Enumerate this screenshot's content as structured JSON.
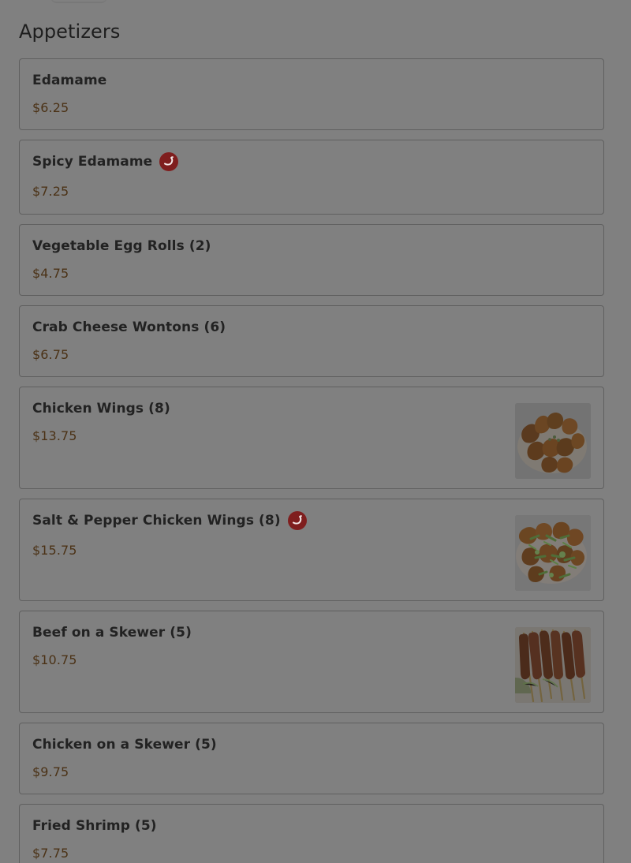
{
  "menu": {
    "section_title": "Appetizers",
    "items": [
      {
        "name": "Edamame",
        "price": "$6.25",
        "spicy": false,
        "image": null
      },
      {
        "name": "Spicy Edamame",
        "price": "$7.25",
        "spicy": true,
        "image": null
      },
      {
        "name": "Vegetable Egg Rolls (2)",
        "price": "$4.75",
        "spicy": false,
        "image": null
      },
      {
        "name": "Crab Cheese Wontons (6)",
        "price": "$6.75",
        "spicy": false,
        "image": null
      },
      {
        "name": "Chicken Wings (8)",
        "price": "$13.75",
        "spicy": false,
        "image": "chicken-wings-photo"
      },
      {
        "name": "Salt & Pepper Chicken Wings (8)",
        "price": "$15.75",
        "spicy": true,
        "image": "salt-pepper-chicken-wings-photo"
      },
      {
        "name": "Beef on a Skewer (5)",
        "price": "$10.75",
        "spicy": false,
        "image": "beef-skewer-photo"
      },
      {
        "name": "Chicken on a Skewer (5)",
        "price": "$9.75",
        "spicy": false,
        "image": null
      },
      {
        "name": "Fried Shrimp (5)",
        "price": "$7.75",
        "spicy": false,
        "image": null
      }
    ]
  },
  "colors": {
    "overlay_gray": "#808080",
    "border": "#5f5f5f",
    "price": "#4b3216",
    "spicy_badge": "#7f1e1e"
  }
}
